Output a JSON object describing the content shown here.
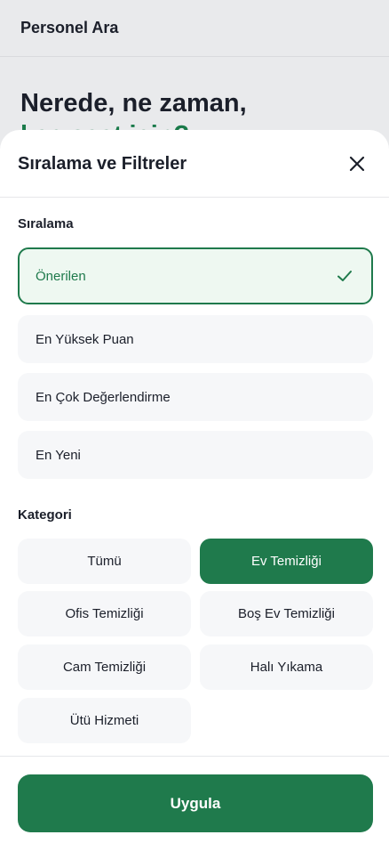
{
  "background": {
    "header_title": "Personel Ara",
    "hero_line1": "Nerede, ne zaman,",
    "hero_line2": "kaç saat için?"
  },
  "sheet": {
    "title": "Sıralama ve Filtreler",
    "close_icon": "close-icon"
  },
  "sorting": {
    "label": "Sıralama",
    "options": [
      {
        "label": "Önerilen",
        "selected": true
      },
      {
        "label": "En Yüksek Puan",
        "selected": false
      },
      {
        "label": "En Çok Değerlendirme",
        "selected": false
      },
      {
        "label": "En Yeni",
        "selected": false
      }
    ]
  },
  "category": {
    "label": "Kategori",
    "items": [
      {
        "label": "Tümü",
        "active": false
      },
      {
        "label": "Ev Temizliği",
        "active": true
      },
      {
        "label": "Ofis Temizliği",
        "active": false
      },
      {
        "label": "Boş Ev Temizliği",
        "active": false
      },
      {
        "label": "Cam Temizliği",
        "active": false
      },
      {
        "label": "Halı Yıkama",
        "active": false
      },
      {
        "label": "Ütü Hizmeti",
        "active": false
      }
    ]
  },
  "footer": {
    "apply_label": "Uygula"
  },
  "colors": {
    "accent": "#1f7a4c",
    "selected_bg": "#eef8f1",
    "option_bg": "#f6f7f9"
  }
}
